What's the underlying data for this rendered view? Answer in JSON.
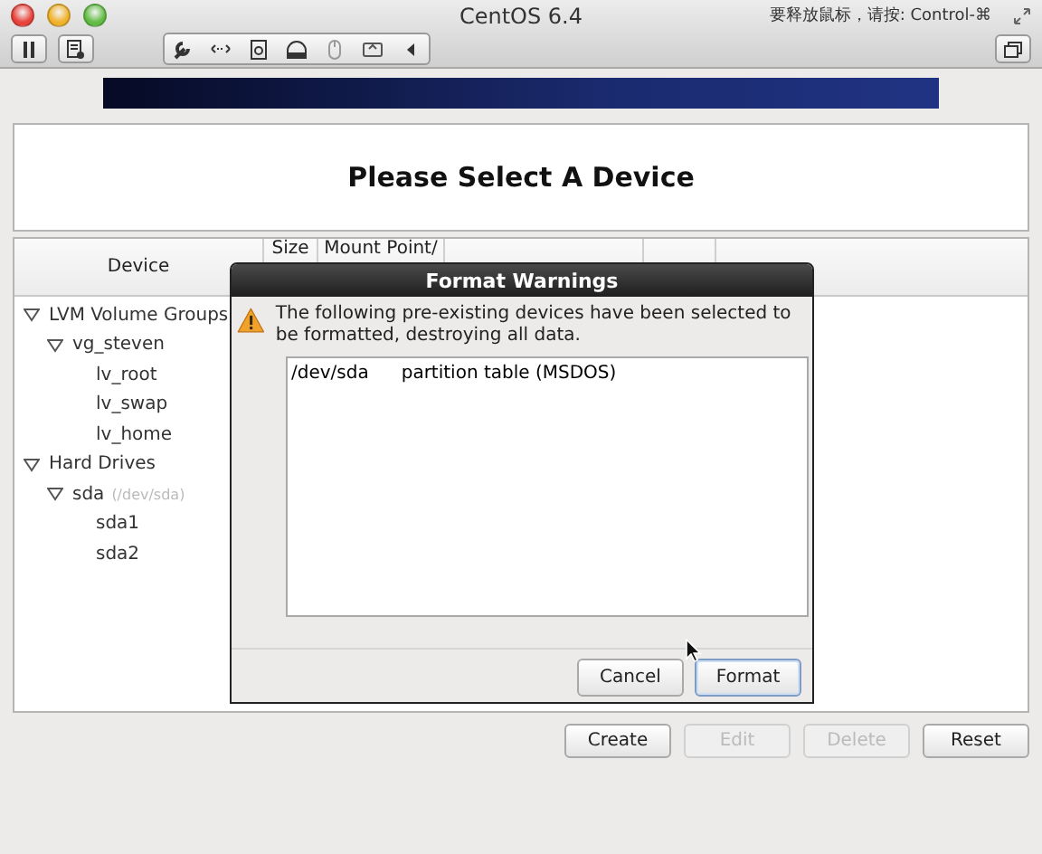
{
  "window": {
    "title": "CentOS 6.4",
    "hint": "要释放鼠标，请按: Control-⌘"
  },
  "heading": "Please Select A Device",
  "table": {
    "columns": [
      "Device",
      "Size",
      "Mount Point/"
    ],
    "tree": [
      {
        "label": "LVM Volume Groups",
        "expanded": true,
        "children": [
          {
            "label": "vg_steven",
            "expanded": true,
            "children": [
              {
                "label": "lv_root"
              },
              {
                "label": "lv_swap"
              },
              {
                "label": "lv_home"
              }
            ]
          }
        ]
      },
      {
        "label": "Hard Drives",
        "expanded": true,
        "children": [
          {
            "label": "sda",
            "detail": "(/dev/sda)",
            "expanded": true,
            "children": [
              {
                "label": "sda1"
              },
              {
                "label": "sda2"
              }
            ]
          }
        ]
      }
    ]
  },
  "buttons": [
    {
      "label": "Create",
      "disabled": false
    },
    {
      "label": "Edit",
      "disabled": true
    },
    {
      "label": "Delete",
      "disabled": true
    },
    {
      "label": "Reset",
      "disabled": false
    }
  ],
  "dialog": {
    "title": "Format Warnings",
    "message": "The following pre-existing devices have been selected to be formatted, destroying all data.",
    "devices": [
      {
        "device": "/dev/sda",
        "description": "partition table (MSDOS)"
      }
    ],
    "buttons": [
      {
        "label": "Cancel",
        "default": false
      },
      {
        "label": "Format",
        "default": true
      }
    ]
  }
}
